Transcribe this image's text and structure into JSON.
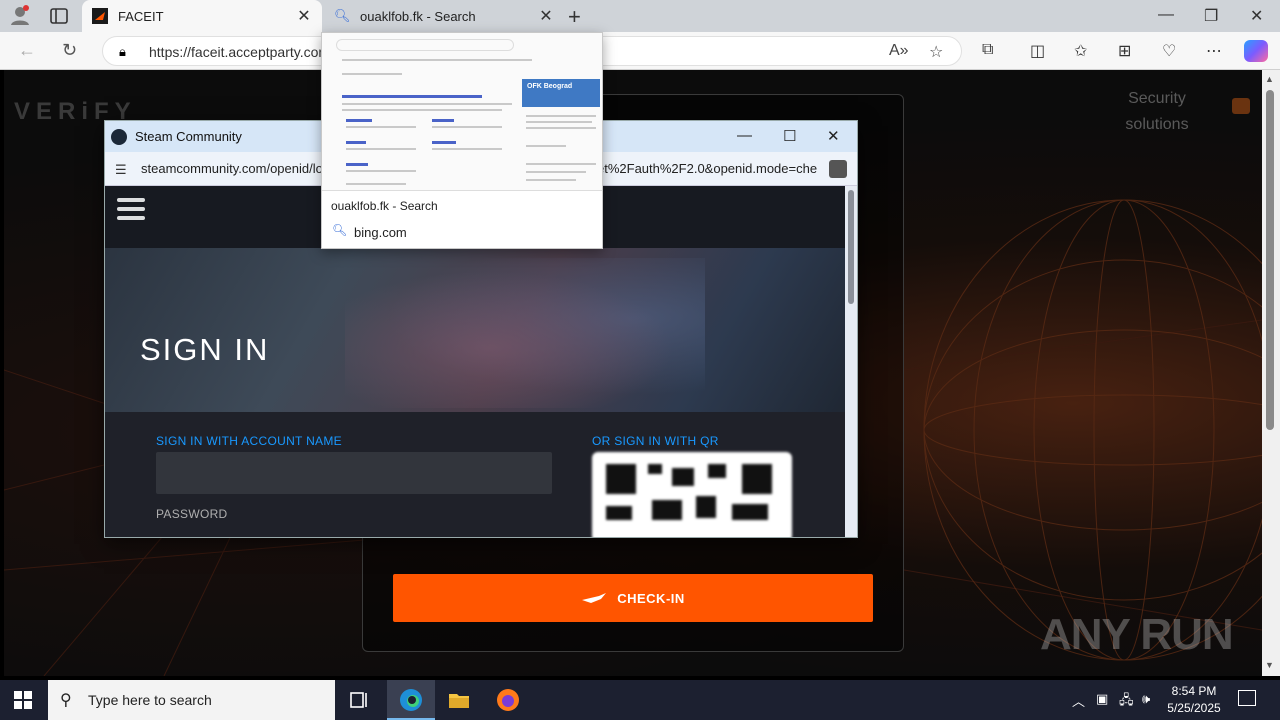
{
  "browser": {
    "tabs": [
      {
        "label": "FACEIT",
        "active": true
      },
      {
        "label": "ouaklfob.fk - Search",
        "active": false
      }
    ],
    "url": "https://faceit.acceptparty.co",
    "url_shown": "https://faceit.acceptparty.com"
  },
  "page": {
    "logo": "VERiFY",
    "security": "Security solutions",
    "checkin_label": "CHECK-IN",
    "watermark": "ANY RUN"
  },
  "steam_window": {
    "title": "Steam Community",
    "url_left": "steamcommunity.com/openid/lo",
    "url_right": "et%2Fauth%2F2.0&openid.mode=che",
    "signin_title": "SIGN IN",
    "account_label": "SIGN IN WITH ACCOUNT NAME",
    "password_label": "PASSWORD",
    "qr_label": "OR SIGN IN WITH QR"
  },
  "tab_preview": {
    "title": "ouaklfob.fk - Search",
    "site": "bing.com",
    "card_title": "OFK Beograd"
  },
  "taskbar": {
    "search_placeholder": "Type here to search",
    "time": "8:54 PM",
    "date": "5/25/2025"
  },
  "colors": {
    "checkin": "#ff5500",
    "steam_blue": "#1999ff",
    "taskbar": "#1c2030"
  }
}
